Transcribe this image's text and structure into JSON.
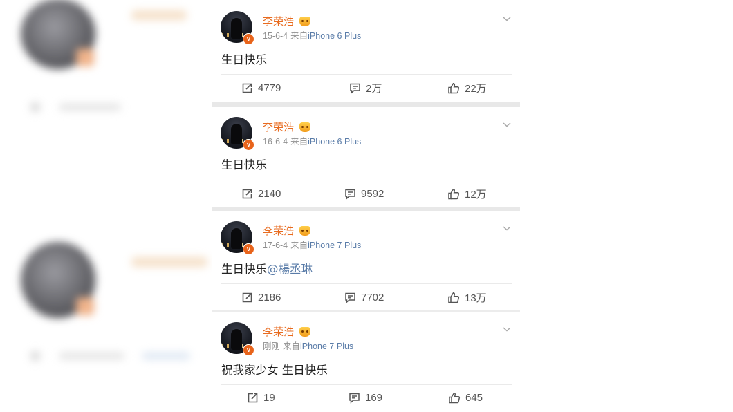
{
  "posts": [
    {
      "author": "李荣浩",
      "date": "15-6-4",
      "source_prefix": "来自",
      "device": "iPhone 6 Plus",
      "text": "生日快乐",
      "mention": "",
      "reposts": "4779",
      "comments": "2万",
      "likes": "22万"
    },
    {
      "author": "李荣浩",
      "date": "16-6-4",
      "source_prefix": "来自",
      "device": "iPhone 6 Plus",
      "text": "生日快乐",
      "mention": "",
      "reposts": "2140",
      "comments": "9592",
      "likes": "12万"
    },
    {
      "author": "李荣浩",
      "date": "17-6-4",
      "source_prefix": "来自",
      "device": "iPhone 7 Plus",
      "text": "生日快乐",
      "mention": "@楊丞琳",
      "reposts": "2186",
      "comments": "7702",
      "likes": "13万"
    },
    {
      "author": "李荣浩",
      "date": "刚刚",
      "source_prefix": "来自",
      "device": "iPhone 7 Plus",
      "text": "祝我家少女 生日快乐",
      "mention": "",
      "reposts": "19",
      "comments": "169",
      "likes": "645"
    }
  ],
  "icons": {
    "verified_badge": "verified-v-icon",
    "crown": "vip-crown-icon",
    "more": "chevron-down-icon",
    "repost": "repost-icon",
    "comment": "comment-icon",
    "like": "thumbs-up-icon"
  },
  "colors": {
    "author": "#e86b1f",
    "meta": "#8f8f8f",
    "device": "#5a7ca8",
    "mention": "#5a7ca8",
    "badge": "#e8641b",
    "separator": "#e8e8e8"
  }
}
